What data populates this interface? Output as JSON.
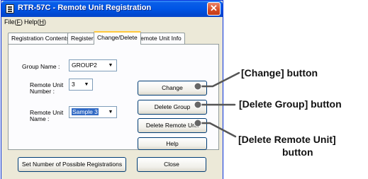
{
  "window": {
    "title": "RTR-57C - Remote Unit Registration",
    "close_glyph": "✕"
  },
  "menubar": {
    "file_prefix": "File(",
    "file_key": "F",
    "file_suffix": ")",
    "help_prefix": "Help(",
    "help_key": "H",
    "help_suffix": ")"
  },
  "tabs": [
    {
      "label": "Registration Contents"
    },
    {
      "label": "Register"
    },
    {
      "label": "Change/Delete"
    },
    {
      "label": "Remote Unit Info"
    }
  ],
  "form": {
    "group_name_label": "Group Name :",
    "group_name_value": "GROUP2",
    "remote_unit_number_label_1": "Remote Unit",
    "remote_unit_number_label_2": "Number :",
    "remote_unit_number_value": "3",
    "remote_unit_name_label_1": "Remote Unit",
    "remote_unit_name_label_2": "Name :",
    "remote_unit_name_value": "Sample 3"
  },
  "buttons": {
    "change": "Change",
    "delete_group": "Delete Group",
    "delete_remote_unit": "Delete Remote Unit",
    "help": "Help",
    "set_number": "Set Number of Possible Registrations",
    "close": "Close"
  },
  "callouts": {
    "change": "[Change] button",
    "delete_group": "[Delete Group] button",
    "delete_remote_unit_1": "[Delete Remote Unit]",
    "delete_remote_unit_2": "button"
  },
  "colors": {
    "titlebar": "#0055e5",
    "window_bg": "#ece9d8",
    "selection": "#316ac5",
    "leader_line": "#555555"
  }
}
